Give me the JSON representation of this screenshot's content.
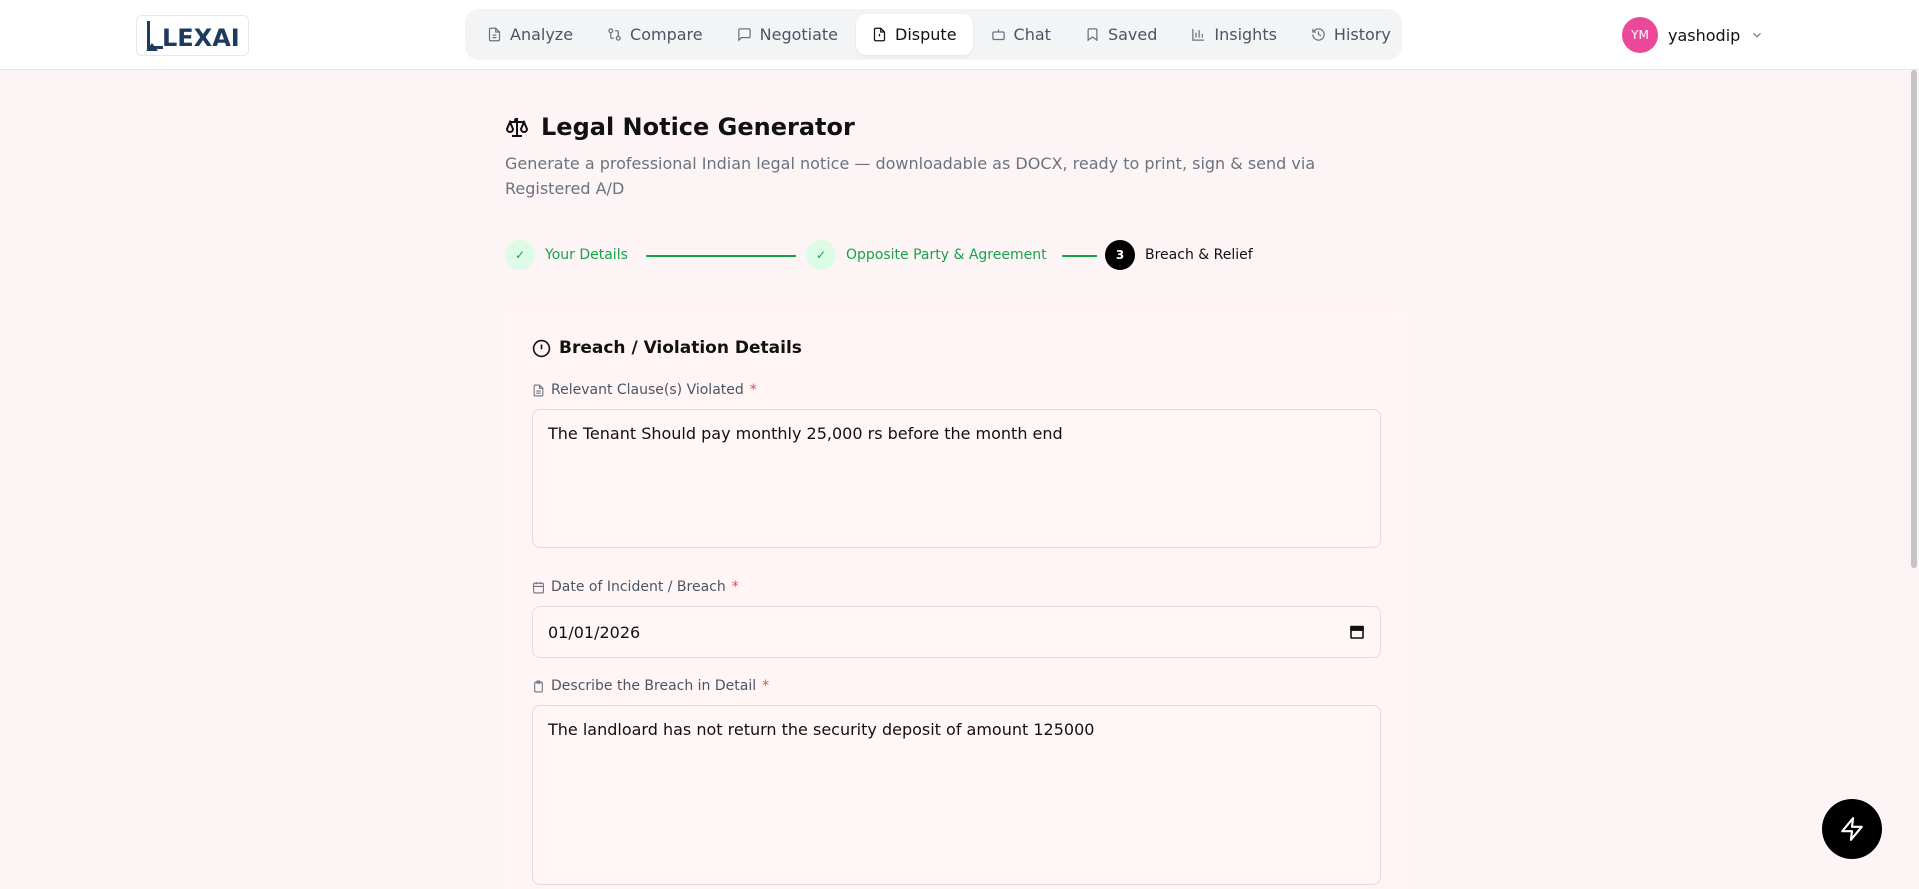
{
  "app": {
    "logo_text": "LEXAI"
  },
  "nav": {
    "items": [
      {
        "label": "Analyze",
        "icon": "file-icon",
        "active": false
      },
      {
        "label": "Compare",
        "icon": "git-compare-icon",
        "active": false
      },
      {
        "label": "Negotiate",
        "icon": "message-square-icon",
        "active": false
      },
      {
        "label": "Dispute",
        "icon": "file-warning-icon",
        "active": true
      },
      {
        "label": "Chat",
        "icon": "bot-icon",
        "active": false
      },
      {
        "label": "Saved",
        "icon": "bookmark-icon",
        "active": false
      },
      {
        "label": "Insights",
        "icon": "bar-chart-icon",
        "active": false
      },
      {
        "label": "History",
        "icon": "history-icon",
        "active": false
      }
    ]
  },
  "user": {
    "initials": "YM",
    "name": "yashodip",
    "avatar_color": "#ec4899"
  },
  "page": {
    "title": "Legal Notice Generator",
    "subtitle": "Generate a professional Indian legal notice — downloadable as DOCX, ready to print, sign & send via Registered A/D"
  },
  "stepper": {
    "steps": [
      {
        "label": "Your Details",
        "state": "done",
        "marker": "✓"
      },
      {
        "label": "Opposite Party & Agreement",
        "state": "done",
        "marker": "✓"
      },
      {
        "label": "Breach & Relief",
        "state": "current",
        "marker": "3"
      }
    ]
  },
  "form": {
    "section_title": "Breach / Violation Details",
    "clause": {
      "label": "Relevant Clause(s) Violated",
      "required_mark": "*",
      "value": "The Tenant Should pay  monthly 25,000 rs before the month end"
    },
    "incident_date": {
      "label": "Date of Incident / Breach",
      "required_mark": "*",
      "value": "01/01/2026"
    },
    "breach_description": {
      "label": "Describe the Breach in Detail",
      "required_mark": "*",
      "value": "The landloard has not return the security deposit of amount 125000"
    }
  },
  "colors": {
    "accent_green": "#16a34a",
    "required_red": "#ef4444",
    "brand_navy": "#1e3a5f"
  }
}
